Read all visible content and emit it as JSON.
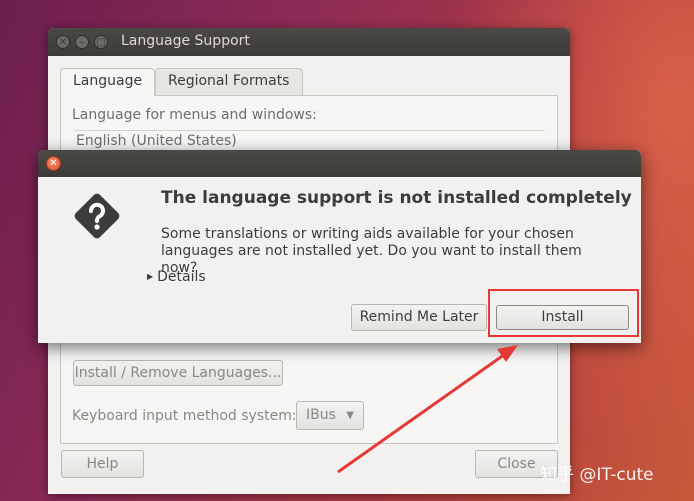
{
  "main_window": {
    "title": "Language Support",
    "tabs": [
      {
        "label": "Language",
        "active": true
      },
      {
        "label": "Regional Formats",
        "active": false
      }
    ],
    "language_label": "Language for menus and windows:",
    "language_items": [
      "English (United States)"
    ],
    "install_remove_label": "Install / Remove Languages...",
    "keyboard_label": "Keyboard input method system:",
    "input_method_value": "IBus",
    "help_label": "Help",
    "close_label": "Close"
  },
  "dialog": {
    "heading": "The language support is not installed completely",
    "body": "Some translations or writing aids available for your chosen languages are not installed yet. Do you want to install them now?",
    "details_label": "Details",
    "remind_label": "Remind Me Later",
    "install_label": "Install"
  },
  "watermark": "知乎 @IT-cute",
  "colors": {
    "titlebar": "#3c3b37",
    "window_bg": "#f2f1f0",
    "annotation": "#e53935",
    "close_button": "#e05a32"
  },
  "icons": {
    "dialog": "question-icon",
    "close": "close-icon",
    "details": "triangle-right-icon",
    "combo": "chevron-down-icon"
  }
}
